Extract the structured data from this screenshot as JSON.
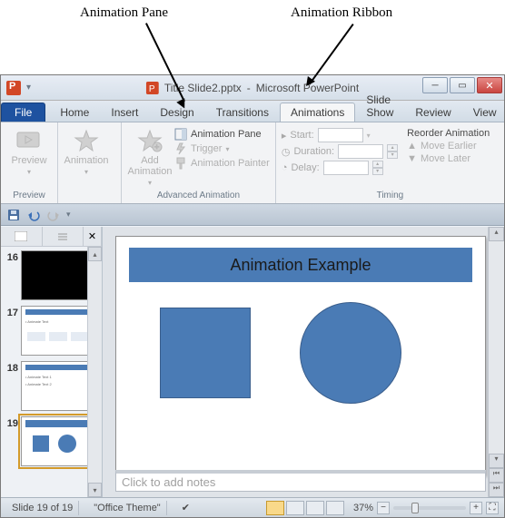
{
  "annotations": {
    "pane": "Animation Pane",
    "ribbon": "Animation Ribbon"
  },
  "title": {
    "document": "Title Slide2.pptx",
    "app": "Microsoft PowerPoint"
  },
  "tabs": {
    "file": "File",
    "home": "Home",
    "insert": "Insert",
    "design": "Design",
    "transitions": "Transitions",
    "animations": "Animations",
    "slideshow": "Slide Show",
    "review": "Review",
    "view": "View"
  },
  "ribbon": {
    "preview": {
      "label": "Preview",
      "group": "Preview"
    },
    "animation": {
      "label": "Animation",
      "group": "Animation"
    },
    "advanced": {
      "add": "Add Animation",
      "pane": "Animation Pane",
      "trigger": "Trigger",
      "painter": "Animation Painter",
      "group": "Advanced Animation"
    },
    "timing": {
      "start": "Start:",
      "duration": "Duration:",
      "delay": "Delay:",
      "reorder": "Reorder Animation",
      "earlier": "Move Earlier",
      "later": "Move Later",
      "group": "Timing"
    }
  },
  "thumbs": {
    "n16": "16",
    "n17": "17",
    "n18": "18",
    "n19": "19"
  },
  "slide": {
    "title": "Animation Example"
  },
  "notes": {
    "placeholder": "Click to add notes"
  },
  "status": {
    "counter": "Slide 19 of 19",
    "theme": "\"Office Theme\"",
    "zoom": "37%"
  }
}
